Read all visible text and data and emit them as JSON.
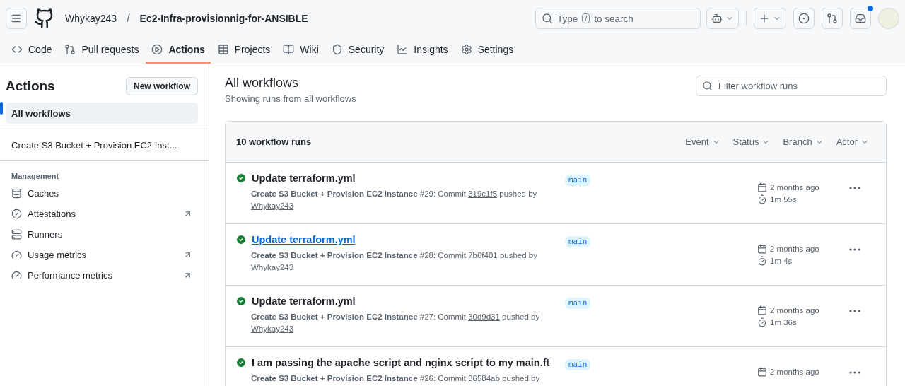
{
  "header": {
    "owner": "Whykay243",
    "separator": "/",
    "repo": "Ec2-Infra-provisionnig-for-ANSIBLE",
    "search": {
      "before": "Type",
      "key": "/",
      "after": "to search"
    },
    "notification_dot": true
  },
  "repo_tabs": [
    {
      "label": "Code",
      "selected": false
    },
    {
      "label": "Pull requests",
      "selected": false
    },
    {
      "label": "Actions",
      "selected": true
    },
    {
      "label": "Projects",
      "selected": false
    },
    {
      "label": "Wiki",
      "selected": false
    },
    {
      "label": "Security",
      "selected": false
    },
    {
      "label": "Insights",
      "selected": false
    },
    {
      "label": "Settings",
      "selected": false
    }
  ],
  "sidebar": {
    "title": "Actions",
    "new_button": "New workflow",
    "workflows": [
      {
        "label": "All workflows",
        "selected": true
      },
      {
        "label": "Create S3 Bucket + Provision EC2 Inst...",
        "selected": false
      }
    ],
    "section_title": "Management",
    "items": [
      {
        "label": "Caches",
        "external": false
      },
      {
        "label": "Attestations",
        "external": true
      },
      {
        "label": "Runners",
        "external": false
      },
      {
        "label": "Usage metrics",
        "external": true
      },
      {
        "label": "Performance metrics",
        "external": true
      }
    ]
  },
  "main": {
    "title": "All workflows",
    "subtitle": "Showing runs from all workflows",
    "filter": {
      "placeholder": "Filter workflow runs"
    },
    "runs_count": "10 workflow runs",
    "filters": [
      "Event",
      "Status",
      "Branch",
      "Actor"
    ],
    "runs": [
      {
        "title": "Update terraform.yml",
        "hovered": false,
        "workflow": "Create S3 Bucket + Provision EC2 Instance",
        "run": "#29: Commit",
        "commit": "319c1f5",
        "pushed_by": "pushed by",
        "author": "Whykay243",
        "branch": "main",
        "date": "2 months ago",
        "duration": "1m 55s"
      },
      {
        "title": "Update terraform.yml",
        "hovered": true,
        "workflow": "Create S3 Bucket + Provision EC2 Instance",
        "run": "#28: Commit",
        "commit": "7b6f401",
        "pushed_by": "pushed by",
        "author": "Whykay243",
        "branch": "main",
        "date": "2 months ago",
        "duration": "1m 4s"
      },
      {
        "title": "Update terraform.yml",
        "hovered": false,
        "workflow": "Create S3 Bucket + Provision EC2 Instance",
        "run": "#27: Commit",
        "commit": "30d9d31",
        "pushed_by": "pushed by",
        "author": "Whykay243",
        "branch": "main",
        "date": "2 months ago",
        "duration": "1m 36s"
      },
      {
        "title": "I am passing the apache script and nginx script to my main.ft",
        "hovered": false,
        "workflow": "Create S3 Bucket + Provision EC2 Instance",
        "run": "#26: Commit",
        "commit": "86584ab",
        "pushed_by": "pushed by",
        "branch": "main",
        "date": "2 months ago"
      }
    ]
  }
}
